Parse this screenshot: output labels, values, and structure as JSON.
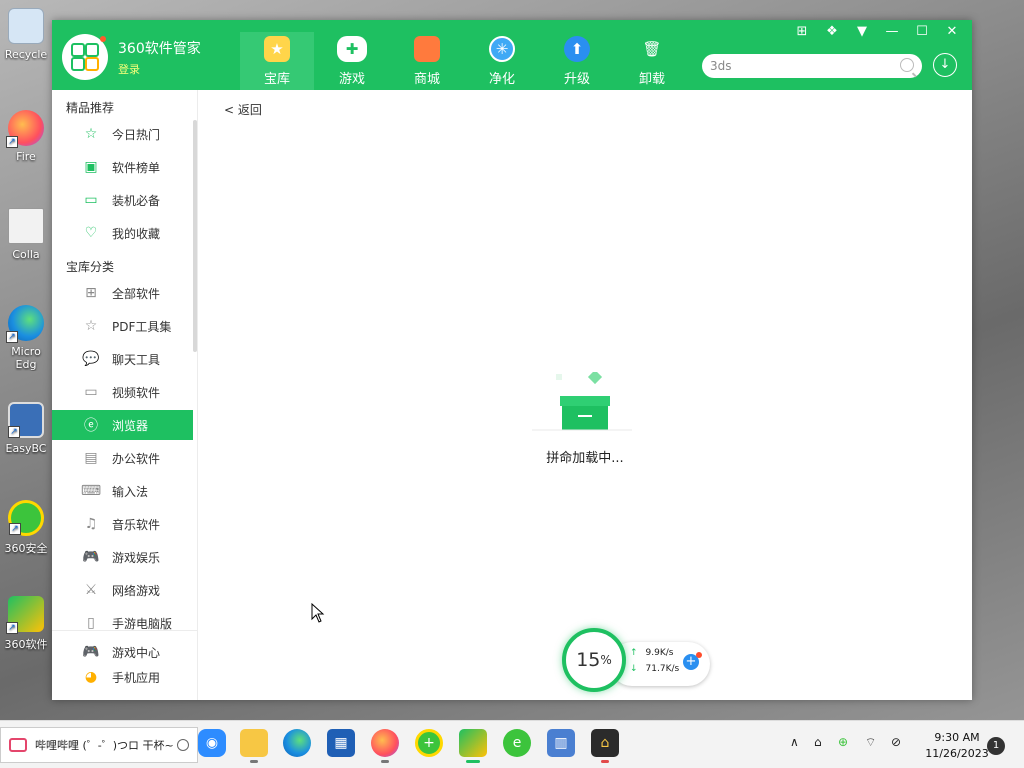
{
  "desktop": {
    "icons": [
      {
        "label": "Recycle"
      },
      {
        "label": "Fire"
      },
      {
        "label": "Colla"
      },
      {
        "label": "Micro Edg"
      },
      {
        "label": "EasyBC"
      },
      {
        "label": "360安全"
      },
      {
        "label": "360软件"
      }
    ]
  },
  "app": {
    "name": "360软件管家",
    "login": "登录",
    "tabs": [
      {
        "label": "宝库",
        "icon": "star-icon",
        "active": true
      },
      {
        "label": "游戏",
        "icon": "gamepad-icon"
      },
      {
        "label": "商城",
        "icon": "shopping-bag-icon"
      },
      {
        "label": "净化",
        "icon": "fan-icon"
      },
      {
        "label": "升级",
        "icon": "upgrade-arrow-icon"
      },
      {
        "label": "卸载",
        "icon": "trash-icon"
      }
    ],
    "window_controls": [
      "grid-icon",
      "skin-icon",
      "menu-down-icon",
      "minimize-icon",
      "maximize-icon",
      "close-icon"
    ],
    "search": {
      "value": "3ds"
    }
  },
  "sidebar": {
    "section1": "精品推荐",
    "featured": [
      {
        "label": "今日热门",
        "icon": "star-outline-icon"
      },
      {
        "label": "软件榜单",
        "icon": "ranking-icon"
      },
      {
        "label": "装机必备",
        "icon": "monitor-icon"
      },
      {
        "label": "我的收藏",
        "icon": "heart-icon"
      }
    ],
    "section2": "宝库分类",
    "categories": [
      {
        "label": "全部软件",
        "icon": "grid-icon"
      },
      {
        "label": "PDF工具集",
        "icon": "star-outline-icon"
      },
      {
        "label": "聊天工具",
        "icon": "chat-icon"
      },
      {
        "label": "视频软件",
        "icon": "video-icon"
      },
      {
        "label": "浏览器",
        "icon": "browser-icon",
        "active": true
      },
      {
        "label": "办公软件",
        "icon": "briefcase-icon"
      },
      {
        "label": "输入法",
        "icon": "keyboard-icon"
      },
      {
        "label": "音乐软件",
        "icon": "music-icon"
      },
      {
        "label": "游戏娱乐",
        "icon": "gamepad-icon"
      },
      {
        "label": "网络游戏",
        "icon": "sword-icon"
      },
      {
        "label": "手游电脑版",
        "icon": "phone-icon"
      }
    ],
    "bottom": [
      {
        "label": "游戏中心",
        "icon": "game-center-icon"
      },
      {
        "label": "手机应用",
        "icon": "mobile-app-icon"
      }
    ]
  },
  "main": {
    "back": "< 返回",
    "loading": "拼命加载中..."
  },
  "speed_widget": {
    "percent": "15",
    "percent_unit": "%",
    "upload": "9.9K/s",
    "download": "71.7K/s"
  },
  "taskbar": {
    "search_text": "哔哩哔哩 (゜-゜)つロ 干杯~",
    "apps": [
      "zoom-icon",
      "file-explorer-icon",
      "edge-icon",
      "store-icon",
      "firefox-icon",
      "360-security-icon",
      "360-software-icon",
      "ie-icon",
      "archive-icon",
      "chart-app-icon"
    ],
    "time": "9:30 AM",
    "date": "11/26/2023",
    "notifications": "1"
  },
  "colors": {
    "accent": "#1ec061",
    "accent_light": "#35c974",
    "login": "#f6ff7a"
  }
}
